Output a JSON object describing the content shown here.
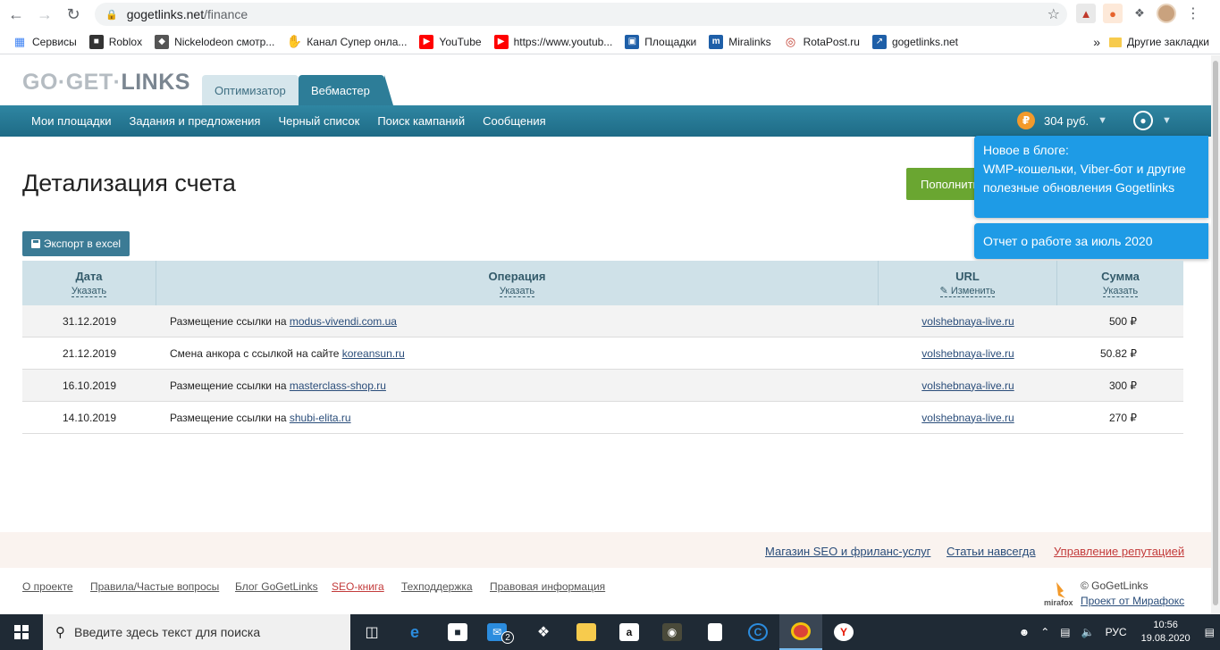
{
  "browser": {
    "url_host": "gogetlinks.net",
    "url_path": "/finance",
    "bookmarks": [
      {
        "label": "Сервисы",
        "color": "#4285f4"
      },
      {
        "label": "Roblox",
        "color": "#333333"
      },
      {
        "label": "Nickelodeon смотр...",
        "color": "#555555"
      },
      {
        "label": "Канал Супер онла...",
        "color": "#e8b800"
      },
      {
        "label": "YouTube",
        "color": "#ff0000"
      },
      {
        "label": "https://www.youtub...",
        "color": "#ff0000"
      },
      {
        "label": "Площадки",
        "color": "#1e5fa8"
      },
      {
        "label": "Miralinks",
        "color": "#1e5fa8"
      },
      {
        "label": "RotaPost.ru",
        "color": "#c0392b"
      },
      {
        "label": "gogetlinks.net",
        "color": "#1e5fa8"
      }
    ],
    "more_bookmarks": "»",
    "other_bookmarks": "Другие закладки"
  },
  "site": {
    "logo_left": "GO·GET·",
    "logo_right": "LINKS",
    "role_tabs": {
      "optimizer": "Оптимизатор",
      "webmaster": "Вебмастер"
    },
    "nav": [
      "Мои площадки",
      "Задания и предложения",
      "Черный список",
      "Поиск кампаний",
      "Сообщения"
    ],
    "balance": "304 руб.",
    "currency_symbol": "₽"
  },
  "page": {
    "title": "Детализация счета",
    "topup_label": "Пополнить",
    "export_label": "Экспорт в excel",
    "popup_news": "Новое в блоге:\nWMP-кошельки, Viber-бот и другие полезные обновления Gogetlinks",
    "popup_report": "Отчет о работе за июль 2020"
  },
  "table": {
    "headers": [
      {
        "title": "Дата",
        "sub": "Указать"
      },
      {
        "title": "Операция",
        "sub": "Указать"
      },
      {
        "title": "URL",
        "sub": "Изменить"
      },
      {
        "title": "Сумма",
        "sub": "Указать"
      }
    ],
    "rows": [
      {
        "date": "31.12.2019",
        "op_text": "Размещение ссылки на ",
        "op_link": "modus-vivendi.com.ua",
        "url": "volshebnaya-live.ru",
        "sum": "500 ₽"
      },
      {
        "date": "21.12.2019",
        "op_text": "Смена анкора с ссылкой на сайте ",
        "op_link": "koreansun.ru",
        "url": "volshebnaya-live.ru",
        "sum": "50.82 ₽"
      },
      {
        "date": "16.10.2019",
        "op_text": "Размещение ссылки на ",
        "op_link": "masterclass-shop.ru",
        "url": "volshebnaya-live.ru",
        "sum": "300 ₽"
      },
      {
        "date": "14.10.2019",
        "op_text": "Размещение ссылки на ",
        "op_link": "shubi-elita.ru",
        "url": "volshebnaya-live.ru",
        "sum": "270 ₽"
      }
    ]
  },
  "footer": {
    "top_links": {
      "seo_shop": "Магазин SEO и фриланс-услуг",
      "articles": "Статьи навсегда",
      "reputation": "Управление репутацией"
    },
    "bottom_links": {
      "about": "О проекте",
      "rules": "Правила/Частые вопросы",
      "blog": "Блог GoGetLinks",
      "seo_book": "SEO-книга",
      "support": "Техподдержка",
      "legal": "Правовая информация"
    },
    "copyright": "© GoGetLinks",
    "project": "Проект от Мирафокс",
    "mirafox": "mirafox"
  },
  "taskbar": {
    "search_placeholder": "Введите здесь текст для поиска",
    "mail_badge": "2",
    "lang": "РУС",
    "time": "10:56",
    "date": "19.08.2020"
  }
}
